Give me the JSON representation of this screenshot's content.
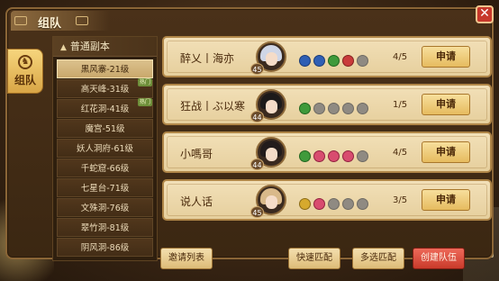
{
  "window": {
    "title": "组队",
    "close_glyph": "✕"
  },
  "side_tab": {
    "label": "组队",
    "icon": "team-icon",
    "icon_glyph": "♞"
  },
  "dungeon_panel": {
    "header": "普通副本",
    "items": [
      {
        "label": "黑风寨-21级",
        "selected": true,
        "badge": ""
      },
      {
        "label": "高天峰-31级",
        "selected": false,
        "badge": "热门"
      },
      {
        "label": "红花洞-41级",
        "selected": false,
        "badge": "热门"
      },
      {
        "label": "魔宫-51级",
        "selected": false,
        "badge": ""
      },
      {
        "label": "妖人洞府-61级",
        "selected": false,
        "badge": ""
      },
      {
        "label": "千蛇窟-66级",
        "selected": false,
        "badge": ""
      },
      {
        "label": "七星台-71级",
        "selected": false,
        "badge": ""
      },
      {
        "label": "文殊洞-76级",
        "selected": false,
        "badge": ""
      },
      {
        "label": "翠竹洞-81级",
        "selected": false,
        "badge": ""
      },
      {
        "label": "阴风洞-86级",
        "selected": false,
        "badge": ""
      }
    ]
  },
  "teams": [
    {
      "name": "醉乂丨海亦",
      "level": "45",
      "slots": [
        "blue",
        "blue",
        "green",
        "red",
        "empty"
      ],
      "count": "4/5",
      "apply_label": "申请"
    },
    {
      "name": "狂战丨ぶ以寒",
      "level": "44",
      "slots": [
        "green",
        "empty",
        "empty",
        "empty",
        "empty"
      ],
      "count": "1/5",
      "apply_label": "申请"
    },
    {
      "name": "小嗎哥",
      "level": "44",
      "slots": [
        "green",
        "pink",
        "pink",
        "pink",
        "empty"
      ],
      "count": "4/5",
      "apply_label": "申请"
    },
    {
      "name": "说人话",
      "level": "45",
      "slots": [
        "yellow",
        "pink",
        "empty",
        "empty",
        "empty"
      ],
      "count": "3/5",
      "apply_label": "申请"
    }
  ],
  "buttons": {
    "invite_list": "邀请列表",
    "quick_match": "快速匹配",
    "multi_match": "多选匹配",
    "create_team": "创建队伍"
  },
  "colors": {
    "accent_red": "#c93a2b",
    "card_bg": "#f2e0b8",
    "button_gold": "#e6bb5f"
  }
}
